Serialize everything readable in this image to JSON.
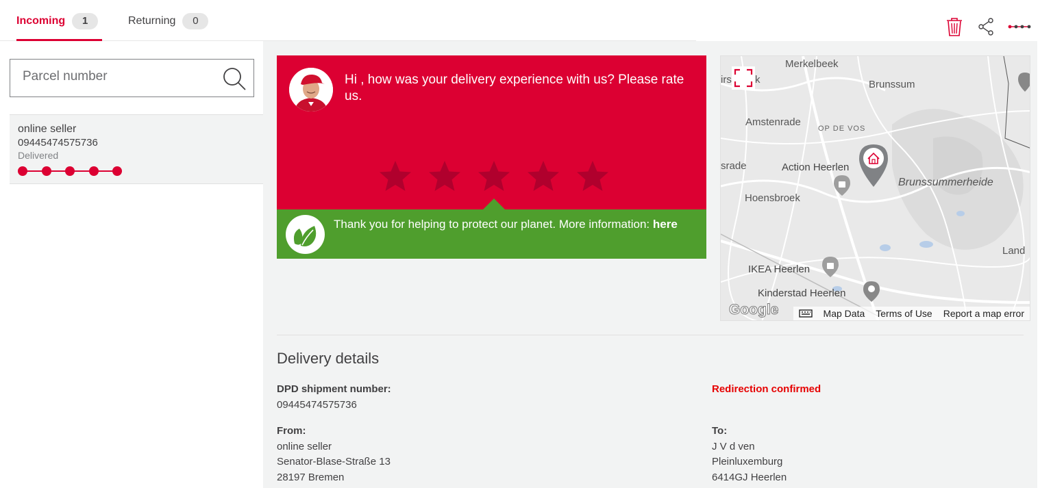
{
  "tabs": {
    "incoming": {
      "label": "Incoming",
      "count": "1"
    },
    "returning": {
      "label": "Returning",
      "count": "0"
    }
  },
  "top_actions": {
    "delete": "trash-icon",
    "share": "share-icon",
    "more": "more-icon"
  },
  "search": {
    "placeholder": "Parcel number"
  },
  "parcels": [
    {
      "seller": "online seller",
      "number": "09445474575736",
      "status": "Delivered",
      "progress_steps_done": 5,
      "progress_steps_total": 5
    }
  ],
  "rating": {
    "question": "Hi , how was your delivery experience with us? Please rate us.",
    "max_stars": 5
  },
  "eco": {
    "text": "Thank you for helping to protect our planet. More information:",
    "link": "here"
  },
  "map": {
    "labels": {
      "merkelbeek": "Merkelbeek",
      "brunssum": "Brunssum",
      "amstenrade": "Amstenrade",
      "opdevos": "OP DE VOS",
      "srade": "srade",
      "action": "Action Heerlen",
      "brunssummerheide": "Brunssummerheide",
      "hoensbroek": "Hoensbroek",
      "ikea": "IKEA Heerlen",
      "kinderstad": "Kinderstad Heerlen",
      "land": "Land",
      "irs": "irs",
      "k": "k"
    },
    "logo": "Google",
    "footer": {
      "map_data": "Map Data",
      "terms": "Terms of Use",
      "report": "Report a map error"
    }
  },
  "details": {
    "title": "Delivery details",
    "shipment_label": "DPD shipment number:",
    "shipment_number": "09445474575736",
    "status": "Redirection confirmed",
    "from_label": "From:",
    "from_name": "online seller",
    "from_street": "Senator-Blase-Straße 13",
    "from_city": "28197 Bremen",
    "to_label": "To:",
    "to_name": "J V d ven",
    "to_street": "Pleinluxemburg",
    "to_city": "6414GJ Heerlen"
  },
  "colors": {
    "brand_red": "#dc0032",
    "eco_green": "#4f9e2d",
    "status_red": "#e60000",
    "star": "#b0002d"
  }
}
